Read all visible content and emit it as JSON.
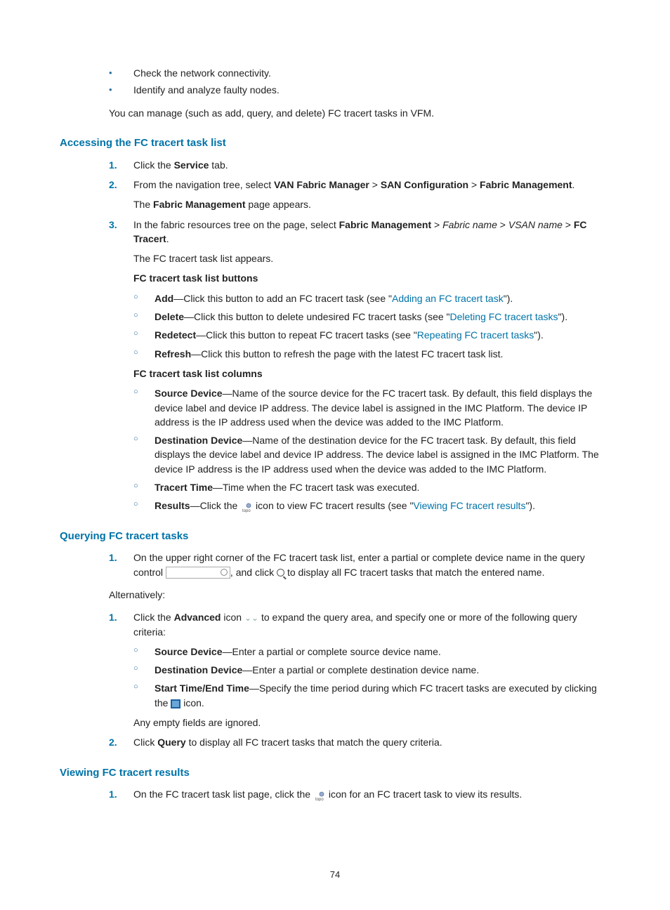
{
  "intro_bullets": [
    "Check the network connectivity.",
    "Identify and analyze faulty nodes."
  ],
  "intro_para": "You can manage (such as add, query, and delete) FC tracert tasks in VFM.",
  "sec1": {
    "title": "Accessing the FC tracert task list",
    "s1": {
      "num": "1.",
      "pre": "Click the ",
      "b": "Service",
      "post": " tab."
    },
    "s2": {
      "num": "2.",
      "pre": "From the navigation tree, select ",
      "b1": "VAN Fabric Manager",
      "gt1": " > ",
      "b2": "SAN Configuration",
      "gt2": " > ",
      "b3": "Fabric Management",
      "post": ".",
      "sub_pre": "The ",
      "sub_b": "Fabric Management",
      "sub_post": " page appears."
    },
    "s3": {
      "num": "3.",
      "pre": "In the fabric resources tree on the page, select ",
      "b1": "Fabric Management",
      "gt1": " > ",
      "i1": "Fabric name",
      "gt2": " > ",
      "i2": "VSAN name",
      "gt3": " > ",
      "b2": "FC Tracert",
      "post": ".",
      "sub": "The FC tracert task list appears."
    },
    "buttons_title": "FC tracert task list buttons",
    "btn_add": {
      "b": "Add",
      "mid": "—Click this button to add an FC tracert task (see \"",
      "link": "Adding an FC tracert task",
      "post": "\")."
    },
    "btn_delete": {
      "b": "Delete",
      "mid": "—Click this button to delete undesired FC tracert tasks (see \"",
      "link": "Deleting FC tracert tasks",
      "post": "\")."
    },
    "btn_redetect": {
      "b": "Redetect",
      "mid": "—Click this button to repeat FC tracert tasks (see \"",
      "link": "Repeating FC tracert tasks",
      "post": "\")."
    },
    "btn_refresh": {
      "b": "Refresh",
      "post": "—Click this button to refresh the page with the latest FC tracert task list."
    },
    "cols_title": "FC tracert task list columns",
    "col_src": {
      "b": "Source Device",
      "post": "—Name of the source device for the FC tracert task. By default, this field displays the device label and device IP address. The device label is assigned in the IMC Platform. The device IP address is the IP address used when the device was added to the IMC Platform."
    },
    "col_dst": {
      "b": "Destination Device",
      "post": "—Name of the destination device for the FC tracert task. By default, this field displays the device label and device IP address. The device label is assigned in the IMC Platform. The device IP address is the IP address used when the device was added to the IMC Platform."
    },
    "col_time": {
      "b": "Tracert Time",
      "post": "—Time when the FC tracert task was executed."
    },
    "col_res": {
      "b": "Results",
      "pre": "—Click the ",
      "mid": " icon to view FC tracert results (see \"",
      "link": "Viewing FC tracert results",
      "post": "\")."
    }
  },
  "sec2": {
    "title": "Querying FC tracert tasks",
    "s1": {
      "num": "1.",
      "pre": "On the upper right corner of the FC tracert task list, enter a partial or complete device name in the query control ",
      "mid": ", and click ",
      "post": " to display all FC tracert tasks that match the entered name."
    },
    "alt": "Alternatively:",
    "a1": {
      "num": "1.",
      "pre": "Click the ",
      "b": "Advanced",
      "mid": " icon ",
      "post": " to expand the query area, and specify one or more of the following query criteria:"
    },
    "qc_src": {
      "b": "Source Device",
      "post": "—Enter a partial or complete source device name."
    },
    "qc_dst": {
      "b": "Destination Device",
      "post": "—Enter a partial or complete destination device name."
    },
    "qc_time": {
      "b": "Start Time/End Time",
      "pre": "—Specify the time period during which FC tracert tasks are executed by clicking the ",
      "post": " icon."
    },
    "ignored": "Any empty fields are ignored.",
    "a2": {
      "num": "2.",
      "pre": "Click ",
      "b": "Query",
      "post": " to display all FC tracert tasks that match the query criteria."
    }
  },
  "sec3": {
    "title": "Viewing FC tracert results",
    "s1": {
      "num": "1.",
      "pre": "On the FC tracert task list page, click the ",
      "post": " icon for an FC tracert task to view its results."
    }
  },
  "page_num": "74"
}
